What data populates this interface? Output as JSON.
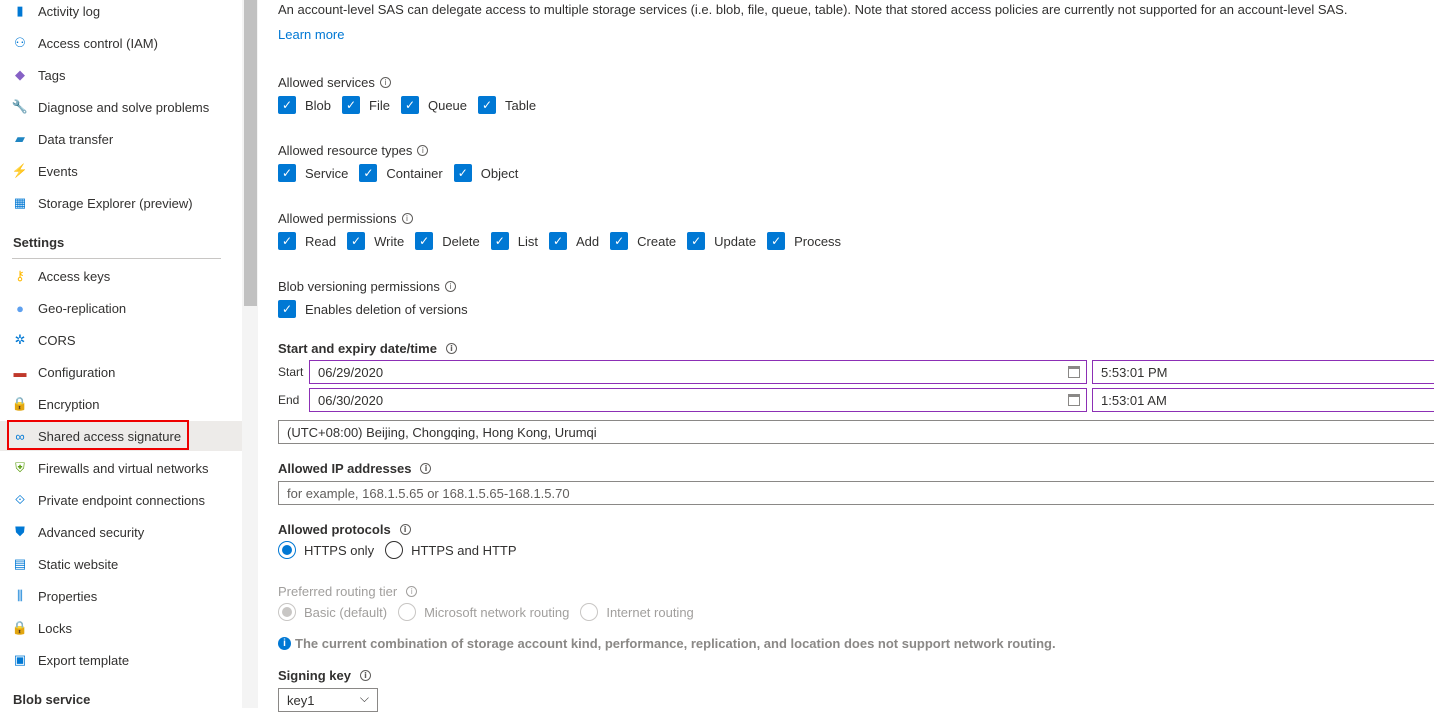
{
  "sidebar": {
    "items_top": [
      {
        "label": "Activity log",
        "icon": "activity-log-icon"
      },
      {
        "label": "Access control (IAM)",
        "icon": "people-icon"
      },
      {
        "label": "Tags",
        "icon": "tag-icon"
      },
      {
        "label": "Diagnose and solve problems",
        "icon": "wrench-icon"
      },
      {
        "label": "Data transfer",
        "icon": "data-transfer-icon"
      },
      {
        "label": "Events",
        "icon": "lightning-icon"
      },
      {
        "label": "Storage Explorer (preview)",
        "icon": "storage-explorer-icon"
      }
    ],
    "settings_header": "Settings",
    "settings_items": [
      {
        "label": "Access keys",
        "icon": "key-icon"
      },
      {
        "label": "Geo-replication",
        "icon": "globe-icon"
      },
      {
        "label": "CORS",
        "icon": "cors-icon"
      },
      {
        "label": "Configuration",
        "icon": "toolbox-icon"
      },
      {
        "label": "Encryption",
        "icon": "lock-icon"
      },
      {
        "label": "Shared access signature",
        "icon": "link-icon",
        "selected": true
      },
      {
        "label": "Firewalls and virtual networks",
        "icon": "firewall-icon"
      },
      {
        "label": "Private endpoint connections",
        "icon": "endpoint-icon"
      },
      {
        "label": "Advanced security",
        "icon": "shield-icon"
      },
      {
        "label": "Static website",
        "icon": "website-icon"
      },
      {
        "label": "Properties",
        "icon": "properties-icon"
      },
      {
        "label": "Locks",
        "icon": "lock-icon"
      },
      {
        "label": "Export template",
        "icon": "export-icon"
      }
    ],
    "blob_header": "Blob service"
  },
  "main": {
    "intro": "An account-level SAS can delegate access to multiple storage services (i.e. blob, file, queue, table). Note that stored access policies are currently not supported for an account-level SAS.",
    "learn_more": "Learn more",
    "services": {
      "label": "Allowed services",
      "options": [
        "Blob",
        "File",
        "Queue",
        "Table"
      ]
    },
    "resource_types": {
      "label": "Allowed resource types",
      "options": [
        "Service",
        "Container",
        "Object"
      ]
    },
    "permissions": {
      "label": "Allowed permissions",
      "options": [
        "Read",
        "Write",
        "Delete",
        "List",
        "Add",
        "Create",
        "Update",
        "Process"
      ]
    },
    "versioning": {
      "label": "Blob versioning permissions",
      "options": [
        "Enables deletion of versions"
      ]
    },
    "dates": {
      "label": "Start and expiry date/time",
      "start_label": "Start",
      "end_label": "End",
      "start_date": "06/29/2020",
      "start_time": "5:53:01 PM",
      "end_date": "06/30/2020",
      "end_time": "1:53:01 AM",
      "timezone": "(UTC+08:00) Beijing, Chongqing, Hong Kong, Urumqi"
    },
    "ip": {
      "label": "Allowed IP addresses",
      "placeholder": "for example, 168.1.5.65 or 168.1.5.65-168.1.5.70"
    },
    "protocols": {
      "label": "Allowed protocols",
      "options": [
        "HTTPS only",
        "HTTPS and HTTP"
      ],
      "selected": "HTTPS only"
    },
    "routing": {
      "label": "Preferred routing tier",
      "options": [
        "Basic (default)",
        "Microsoft network routing",
        "Internet routing"
      ],
      "selected": "Basic (default)",
      "disabled": true,
      "note": "The current combination of storage account kind, performance, replication, and location does not support network routing."
    },
    "signing_key": {
      "label": "Signing key",
      "value": "key1"
    }
  },
  "colors": {
    "accent": "#0078d4",
    "focus_border": "#8c2fb5",
    "highlight": "#e00000"
  }
}
